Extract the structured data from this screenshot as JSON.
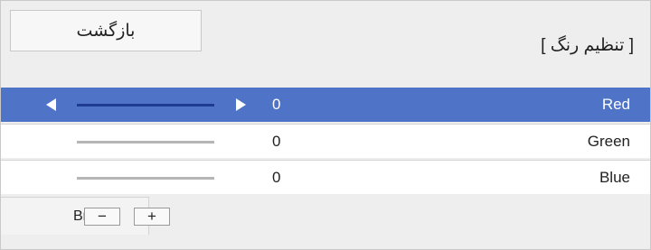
{
  "header": {
    "back_label": "بازگشت",
    "title": "[ تنظیم رنگ ]"
  },
  "rows": [
    {
      "label": "Red",
      "value": "0",
      "selected": true
    },
    {
      "label": "Green",
      "value": "0",
      "selected": false
    },
    {
      "label": "Blue",
      "value": "0",
      "selected": false
    }
  ],
  "footer": {
    "partial_label": "Br",
    "minus_label": "−",
    "plus_label": "+"
  },
  "colors": {
    "selected_row": "#4f73c6",
    "selected_track": "#1e3d92",
    "panel_bg": "#eeeeee"
  },
  "icons": {
    "decrease": "triangle-left-icon",
    "increase": "triangle-right-icon"
  }
}
